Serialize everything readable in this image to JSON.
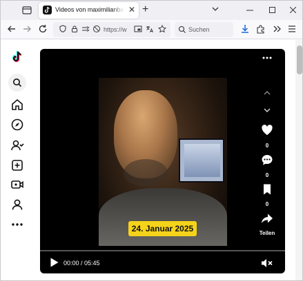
{
  "browser": {
    "tab_title": "Videos von maximilianbaehring",
    "url_prefix": "https://w",
    "search_placeholder": "Suchen",
    "new_tab_symbol": "+",
    "close_symbol": "✕"
  },
  "sidebar": {
    "items": [
      "tiktok-logo",
      "search-icon",
      "home-icon",
      "explore-icon",
      "following-icon",
      "upload-icon",
      "live-icon",
      "profile-icon",
      "more-icon"
    ]
  },
  "video": {
    "date_caption": "24. Januar 2025",
    "like_count": "0",
    "comment_count": "0",
    "bookmark_count": "0",
    "share_label": "Teilen",
    "time_display": "00:00 / 05:45",
    "progress_fraction": 0
  }
}
